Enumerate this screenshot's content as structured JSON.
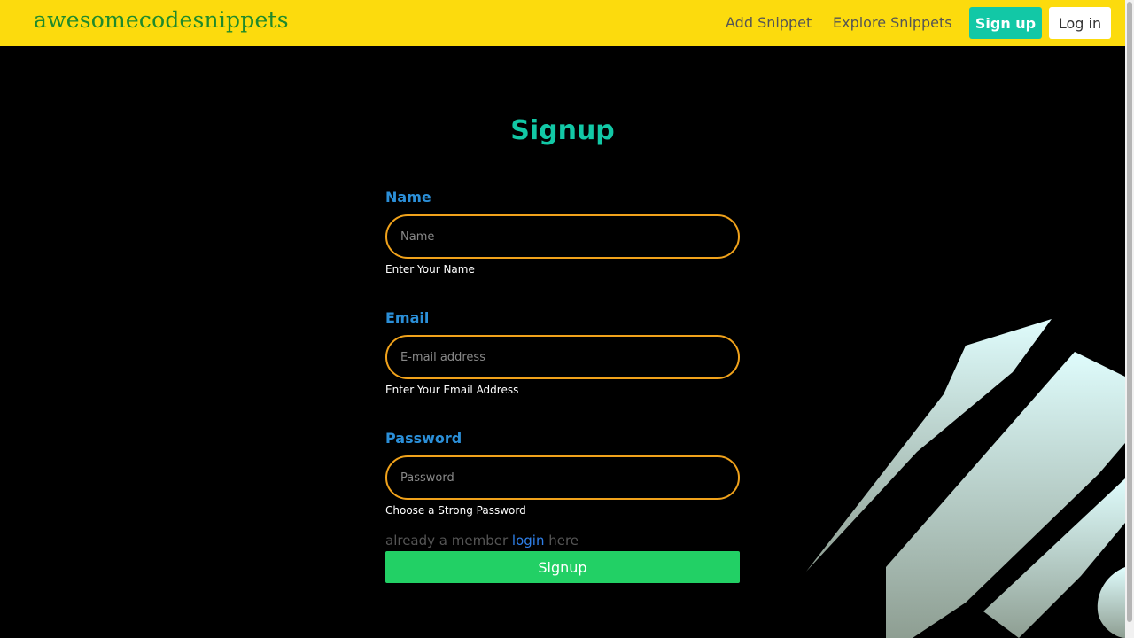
{
  "nav": {
    "brand": "awesomecodesnippets",
    "add_snippet": "Add Snippet",
    "explore_snippets": "Explore Snippets",
    "signup": "Sign up",
    "login": "Log in"
  },
  "form": {
    "title": "Signup",
    "name": {
      "label": "Name",
      "placeholder": "Name",
      "help": "Enter Your Name"
    },
    "email": {
      "label": "Email",
      "placeholder": "E-mail address",
      "help": "Enter Your Email Address"
    },
    "password": {
      "label": "Password",
      "placeholder": "Password",
      "help": "Choose a Strong Password"
    },
    "member_prefix": "already a member",
    "member_link": "login",
    "member_suffix": "here",
    "submit": "Signup"
  },
  "colors": {
    "navbar": "#fcdb0d",
    "brand": "#1f8a2b",
    "accent": "#12c8a6",
    "label": "#2b8fd8",
    "input_border": "#f0a21b",
    "submit": "#22d065",
    "link": "#2e7fe8"
  }
}
